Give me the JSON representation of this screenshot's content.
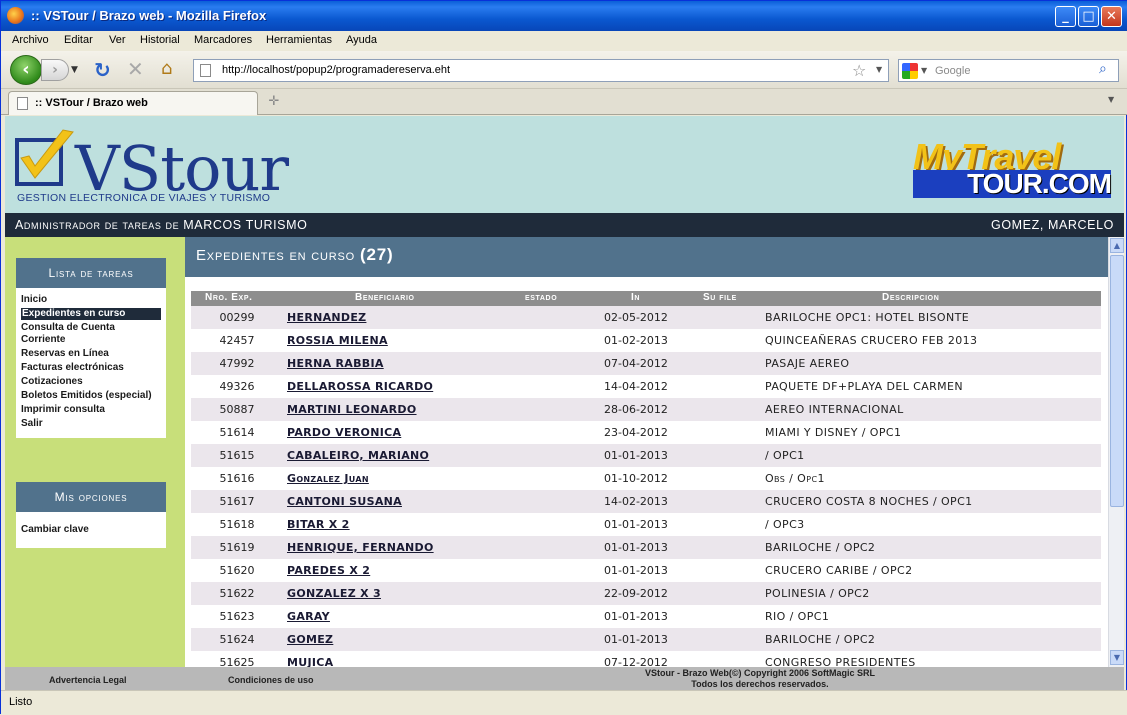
{
  "window": {
    "title": ":: VSTour / Brazo web - Mozilla Firefox",
    "minimize": "_",
    "maximize": "□",
    "close": "✕"
  },
  "menu": [
    "Archivo",
    "Editar",
    "Ver",
    "Historial",
    "Marcadores",
    "Herramientas",
    "Ayuda"
  ],
  "nav": {
    "url": "http://localhost/popup2/programadereserva.eht",
    "search_placeholder": "Google"
  },
  "tab": {
    "title": ":: VSTour / Brazo web"
  },
  "site": {
    "logo_text": "VStour",
    "logo_tagline": "GESTION ELECTRONICA DE VIAJES Y TURISMO",
    "partner_logo_top": "MyTravel",
    "partner_logo_bottom": "TOUR.COM",
    "admin_text": "Administrador de tareas de MARCOS TURISMO",
    "user_name": "GOMEZ, MARCELO"
  },
  "sidebar": {
    "tasks_title": "Lista de tareas",
    "tasks": [
      "Inicio",
      "Expedientes en curso",
      "Consulta de Cuenta Corriente",
      "Reservas en Línea",
      "Facturas electrónicas",
      "Cotizaciones",
      "Boletos Emitidos (especial)",
      "Imprimir consulta",
      "Salir"
    ],
    "options_title": "Mis opciones",
    "options": [
      "Cambiar clave"
    ]
  },
  "main": {
    "title": "Expedientes en curso",
    "count": "(27)",
    "columns": {
      "exp": "Nro. Exp.",
      "ben": "Beneficiario",
      "estado": "estado",
      "in": "In",
      "sufile": "Su file",
      "desc": "Descripcion"
    },
    "rows": [
      {
        "exp": "00299",
        "ben": "HERNANDEZ",
        "in": "02-05-2012",
        "desc": "BARILOCHE OPC1: HOTEL BISONTE"
      },
      {
        "exp": "42457",
        "ben": "ROSSIA MILENA",
        "in": "01-02-2013",
        "desc": "QUINCEAÑERAS CRUCERO FEB 2013"
      },
      {
        "exp": "47992",
        "ben": "HERNA RABBIA",
        "in": "07-04-2012",
        "desc": "PASAJE AEREO"
      },
      {
        "exp": "49326",
        "ben": "DELLAROSSA RICARDO",
        "in": "14-04-2012",
        "desc": "PAQUETE DF+PLAYA DEL CARMEN"
      },
      {
        "exp": "50887",
        "ben": "MARTINI LEONARDO",
        "in": "28-06-2012",
        "desc": "AEREO INTERNACIONAL"
      },
      {
        "exp": "51614",
        "ben": "PARDO VERONICA",
        "in": "23-04-2012",
        "desc": "MIAMI Y DISNEY / OPC1"
      },
      {
        "exp": "51615",
        "ben": "CABALEIRO, MARIANO",
        "in": "01-01-2013",
        "desc": "/ OPC1"
      },
      {
        "exp": "51616",
        "ben": "Gonzalez Juan",
        "in": "01-10-2012",
        "desc": "Obs / Opc1"
      },
      {
        "exp": "51617",
        "ben": "CANTONI SUSANA",
        "in": "14-02-2013",
        "desc": "CRUCERO COSTA 8 NOCHES / OPC1"
      },
      {
        "exp": "51618",
        "ben": "BITAR X 2",
        "in": "01-01-2013",
        "desc": "/ OPC3"
      },
      {
        "exp": "51619",
        "ben": "HENRIQUE, FERNANDO",
        "in": "01-01-2013",
        "desc": "BARILOCHE / OPC2"
      },
      {
        "exp": "51620",
        "ben": "PAREDES X 2",
        "in": "01-01-2013",
        "desc": "CRUCERO CARIBE / OPC2"
      },
      {
        "exp": "51622",
        "ben": "GONZALEZ X 3",
        "in": "22-09-2012",
        "desc": "POLINESIA / OPC2"
      },
      {
        "exp": "51623",
        "ben": "GARAY",
        "in": "01-01-2013",
        "desc": "RIO / OPC1"
      },
      {
        "exp": "51624",
        "ben": "GOMEZ",
        "in": "01-01-2013",
        "desc": "BARILOCHE / OPC2"
      },
      {
        "exp": "51625",
        "ben": "MUJICA",
        "in": "07-12-2012",
        "desc": "CONGRESO PRESIDENTES"
      }
    ]
  },
  "footer": {
    "legal": "Advertencia Legal",
    "terms": "Condiciones de uso",
    "copyright_line1": "VStour - Brazo Web(©) Copyright 2006 SoftMagic SRL",
    "copyright_line2": "Todos los derechos reservados."
  },
  "status": {
    "text": "Listo"
  }
}
